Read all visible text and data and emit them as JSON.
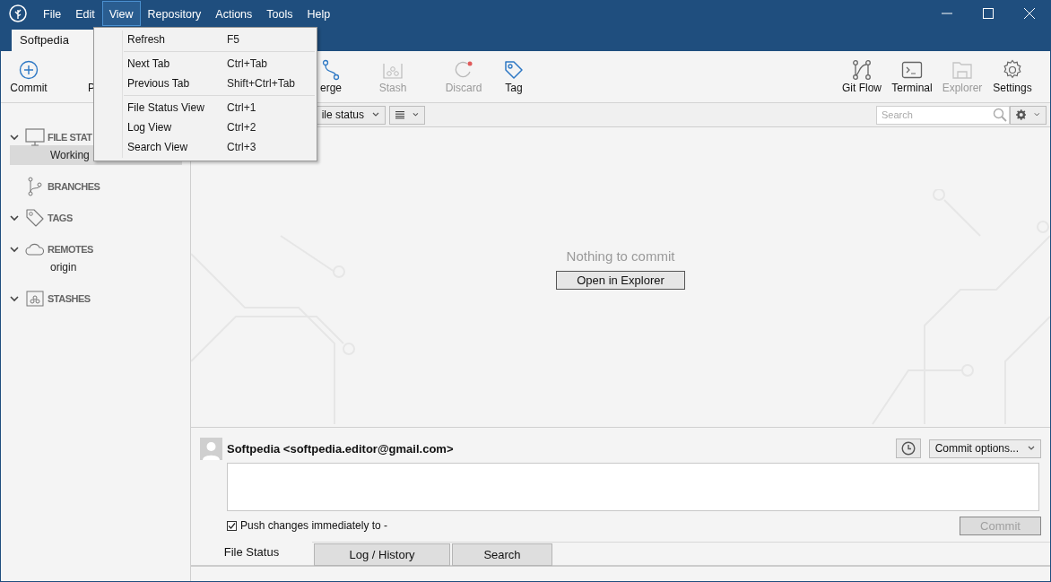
{
  "menu_bar": [
    {
      "label": "File",
      "selected": false
    },
    {
      "label": "Edit",
      "selected": false
    },
    {
      "label": "View",
      "selected": true
    },
    {
      "label": "Repository",
      "selected": false
    },
    {
      "label": "Actions",
      "selected": false
    },
    {
      "label": "Tools",
      "selected": false
    },
    {
      "label": "Help",
      "selected": false
    }
  ],
  "repo_tabs": [
    {
      "label": "Softpedia",
      "selected": true
    }
  ],
  "toolbar_left": [
    {
      "label": "Commit",
      "disabled": false
    },
    {
      "label": "P",
      "disabled": false
    },
    {
      "label": "erge",
      "disabled": false
    },
    {
      "label": "Stash",
      "disabled": true
    },
    {
      "label": "Discard",
      "disabled": true
    },
    {
      "label": "Tag",
      "disabled": false
    }
  ],
  "toolbar_right": [
    {
      "label": "Git Flow",
      "disabled": false
    },
    {
      "label": "Terminal",
      "disabled": false
    },
    {
      "label": "Explorer",
      "disabled": true
    },
    {
      "label": "Settings",
      "disabled": false
    }
  ],
  "sidebar": [
    {
      "label": "FILE STAT",
      "chevron": true,
      "children": [
        {
          "label": "Working",
          "selected": true
        }
      ]
    },
    {
      "label": "BRANCHES",
      "chevron": false
    },
    {
      "label": "TAGS",
      "chevron": true
    },
    {
      "label": "REMOTES",
      "chevron": true,
      "children": [
        {
          "label": "origin",
          "selected": false
        }
      ]
    },
    {
      "label": "STASHES",
      "chevron": true
    }
  ],
  "filter_bar": {
    "status_filter": "ile status",
    "search": {
      "placeholder": "Search"
    }
  },
  "content": {
    "message": "Nothing to commit",
    "button": "Open in Explorer"
  },
  "commit_panel": {
    "author": "Softpedia <softpedia.editor@gmail.com>",
    "options": "Commit options...",
    "push_label": "Push changes immediately to -",
    "push_checked": true,
    "commit_button": "Commit",
    "commit_disabled": true
  },
  "bottom_tabs": [
    {
      "label": "File Status",
      "selected": true
    },
    {
      "label": "Log / History",
      "selected": false
    },
    {
      "label": "Search",
      "selected": false
    }
  ],
  "view_menu": [
    {
      "kind": "item",
      "label": "Refresh",
      "shortcut": "F5"
    },
    {
      "kind": "separator"
    },
    {
      "kind": "item",
      "label": "Next Tab",
      "shortcut": "Ctrl+Tab"
    },
    {
      "kind": "item",
      "label": "Previous Tab",
      "shortcut": "Shift+Ctrl+Tab"
    },
    {
      "kind": "separator"
    },
    {
      "kind": "item",
      "label": "File Status View",
      "shortcut": "Ctrl+1"
    },
    {
      "kind": "item",
      "label": "Log View",
      "shortcut": "Ctrl+2"
    },
    {
      "kind": "item",
      "label": "Search View",
      "shortcut": "Ctrl+3"
    }
  ]
}
